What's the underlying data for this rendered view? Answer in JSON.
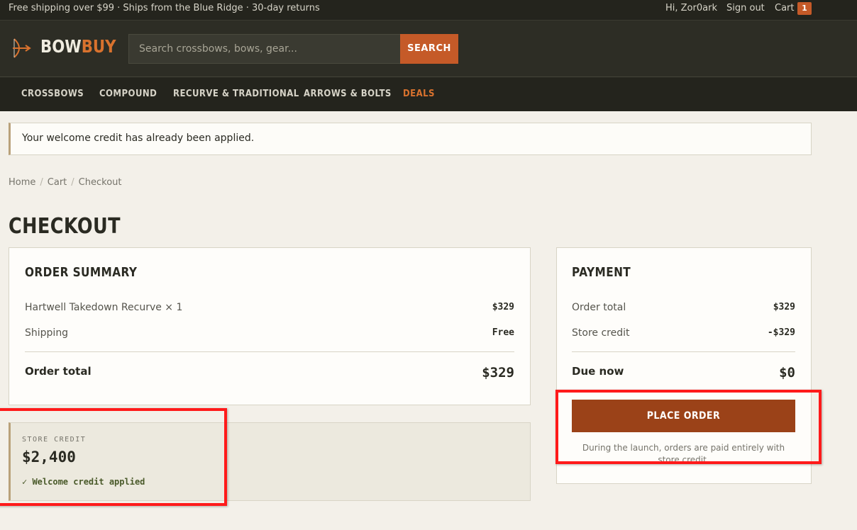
{
  "topbar": {
    "promo": "Free shipping over $99 · Ships from the Blue Ridge · 30-day returns",
    "greeting": "Hi, Zor0ark",
    "signout": "Sign out",
    "cart_label": "Cart",
    "cart_count": "1"
  },
  "header": {
    "logo_bow": "BOW",
    "logo_buy": "BUY",
    "search_placeholder": "Search crossbows, bows, gear...",
    "search_button": "SEARCH"
  },
  "nav": {
    "items": [
      "CROSSBOWS",
      "COMPOUND",
      "RECURVE & TRADITIONAL",
      "ARROWS & BOLTS",
      "DEALS"
    ]
  },
  "notice": "Your welcome credit has already been applied.",
  "breadcrumb": [
    "Home",
    "Cart",
    "Checkout"
  ],
  "page_title": "CHECKOUT",
  "order_summary": {
    "title": "ORDER SUMMARY",
    "rows": [
      {
        "label": "Hartwell Takedown Recurve × 1",
        "value": "$329"
      },
      {
        "label": "Shipping",
        "value": "Free"
      }
    ],
    "total_label": "Order total",
    "total_value": "$329"
  },
  "store_credit": {
    "label": "STORE CREDIT",
    "amount": "$2,400",
    "note": "✓ Welcome credit applied"
  },
  "payment": {
    "title": "PAYMENT",
    "rows": [
      {
        "label": "Order total",
        "value": "$329"
      },
      {
        "label": "Store credit",
        "value": "-$329"
      }
    ],
    "due_label": "Due now",
    "due_value": "$0",
    "place_order": "PLACE ORDER",
    "note": "During the launch, orders are paid entirely with store credit."
  },
  "colors": {
    "accent": "#c55a28",
    "button": "#9b4218",
    "highlight": "#ff1a1a"
  }
}
